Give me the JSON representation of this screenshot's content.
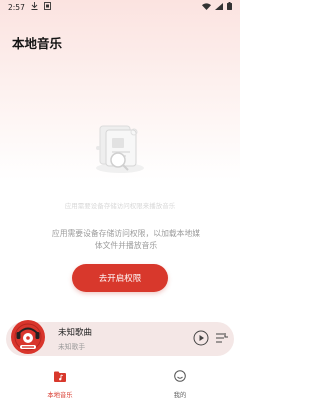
{
  "status_bar": {
    "time": "2:57",
    "icons": [
      "download-icon",
      "screenshot-icon",
      "wifi-icon",
      "signal-icon",
      "battery-icon"
    ]
  },
  "header": {
    "title": "本地音乐"
  },
  "empty_state": {
    "illustration_icon": "document-search-illustration",
    "faint_caption": "应用需要设备存储访问权限来播放音乐",
    "message": "应用需要设备存储访问权限，以加载本地媒体文件并播放音乐",
    "button_label": "去开启权限"
  },
  "mini_player": {
    "title": "未知歌曲",
    "artist": "未知歌手",
    "album_icon": "vinyl-record-icon",
    "play_icon": "play-icon",
    "playlist_icon": "playlist-icon"
  },
  "bottom_nav": {
    "items": [
      {
        "label": "本地音乐",
        "icon": "music-folder-icon",
        "active": true
      },
      {
        "label": "我的",
        "icon": "smiley-icon",
        "active": false
      }
    ]
  },
  "colors": {
    "accent": "#d8382c",
    "mini_player_bg": "#f4e7e6",
    "header_gradient": "#fbe3e0"
  }
}
